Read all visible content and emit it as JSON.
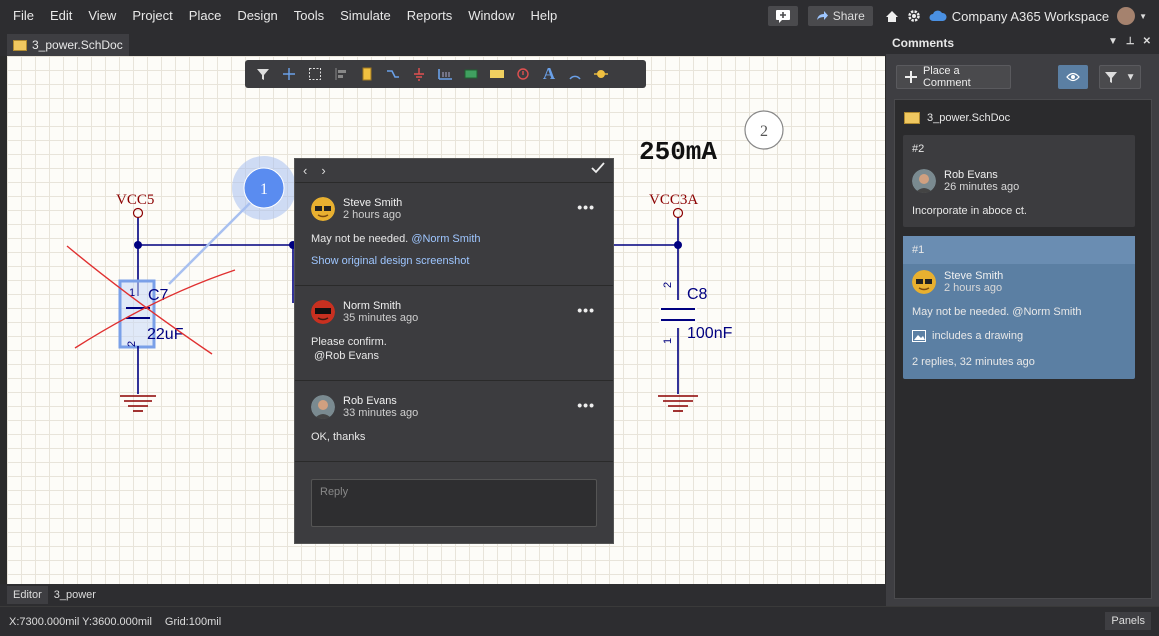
{
  "menu": [
    "File",
    "Edit",
    "View",
    "Project",
    "Place",
    "Design",
    "Tools",
    "Simulate",
    "Reports",
    "Window",
    "Help"
  ],
  "topbar": {
    "share_label": "Share",
    "workspace": "Company A365 Workspace"
  },
  "doc_tab": {
    "label": "3_power.SchDoc"
  },
  "schematic": {
    "vcc_left": "VCC5",
    "vcc_right": "VCC3A",
    "c7_ref": "C7",
    "c7_value": "22uF",
    "c8_ref": "C8",
    "c8_value": "100nF",
    "pin1": "1",
    "pin2": "2",
    "current_label": "250mA",
    "marker1": "1",
    "marker2": "2"
  },
  "popup": {
    "comments": [
      {
        "user": "Steve Smith",
        "time": "2 hours ago",
        "text": "May not be needed.",
        "mention": "@Norm Smith",
        "link": "Show original design screenshot"
      },
      {
        "user": "Norm Smith",
        "time": "35 minutes ago",
        "text": "Please confirm.",
        "mention": "@Rob Evans"
      },
      {
        "user": "Rob Evans",
        "time": "33 minutes ago",
        "text": "OK, thanks"
      }
    ],
    "reply_placeholder": "Reply",
    "dots": "•••"
  },
  "bottom_tabs": {
    "editor": "Editor",
    "doc": "3_power"
  },
  "status": {
    "coords": "X:7300.000mil Y:3600.000mil",
    "grid": "Grid:100mil",
    "panels": "Panels"
  },
  "panel": {
    "title": "Comments",
    "place_label": "Place a Comment",
    "doc_name": "3_power.SchDoc",
    "cards": [
      {
        "num": "#2",
        "user": "Rob Evans",
        "time": "26 minutes ago",
        "text": "Incorporate in aboce ct."
      },
      {
        "num": "#1",
        "user": "Steve Smith",
        "time": "2 hours ago",
        "text": "May not be needed. @Norm Smith",
        "drawing": "includes a drawing",
        "replies": "2 replies, 32 minutes ago"
      }
    ]
  },
  "colors": {
    "accent": "#5b7fa3",
    "schem_red": "#8b0000",
    "schem_blue": "#000080",
    "marker_blue": "#5a8cf0"
  }
}
